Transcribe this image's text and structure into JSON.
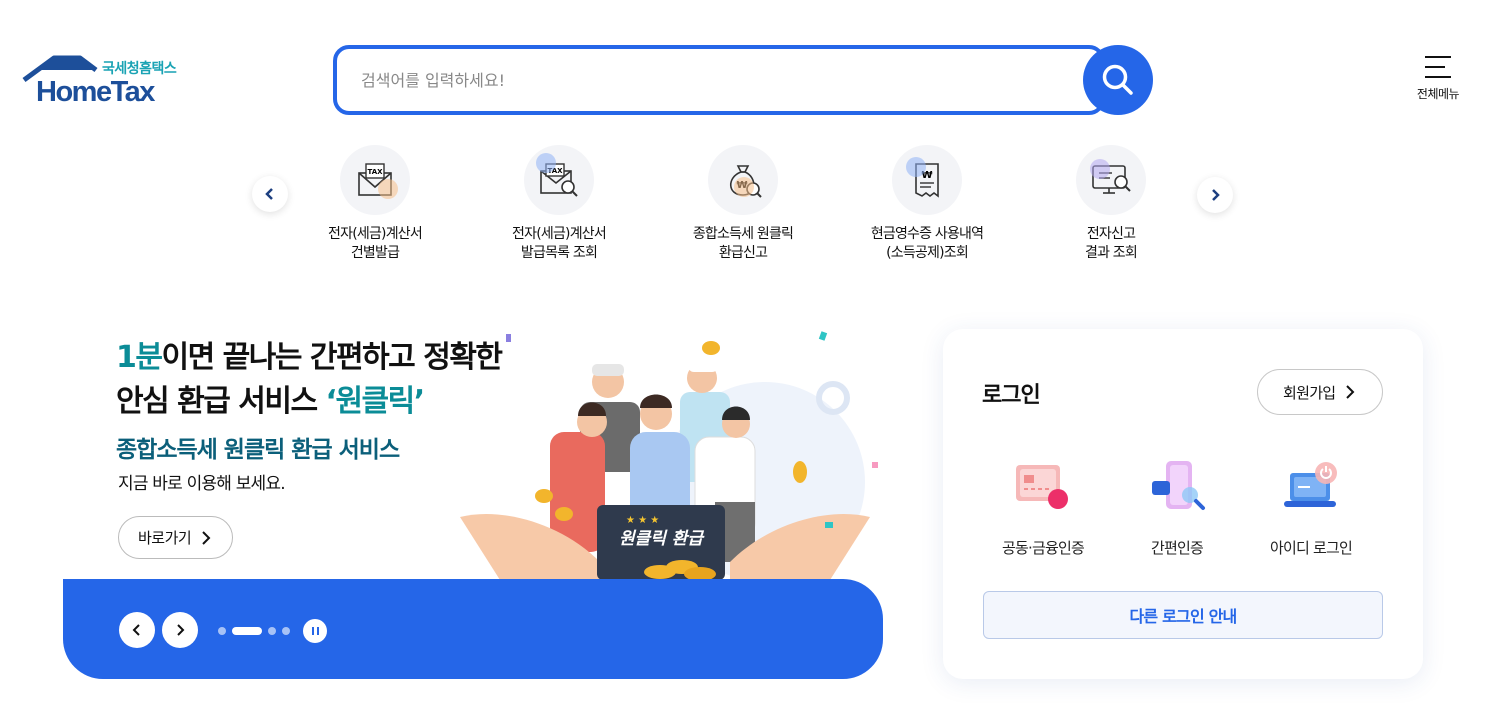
{
  "header": {
    "logo_sub": "국세청홈택스",
    "logo_main": "HomeTax",
    "search_placeholder": "검색어를 입력하세요!",
    "menu_label": "전체메뉴"
  },
  "quick_menu": {
    "items": [
      {
        "label": "전자(세금)계산서\n건별발급",
        "icon": "tax-envelope-icon"
      },
      {
        "label": "전자(세금)계산서\n발급목록 조회",
        "icon": "tax-search-icon"
      },
      {
        "label": "종합소득세 원클릭\n환급신고",
        "icon": "money-bag-icon"
      },
      {
        "label": "현금영수증 사용내역\n(소득공제)조회",
        "icon": "receipt-icon"
      },
      {
        "label": "전자신고\n결과 조회",
        "icon": "monitor-search-icon"
      }
    ]
  },
  "banner": {
    "title_highlight": "1분",
    "title_line1_rest": "이면 끝나는 간편하고 정확한",
    "title_line2": "안심 환급 서비스 ",
    "title_line2_highlight": "‘원클릭’",
    "subtitle": "종합소득세 원클릭 환급 서비스",
    "description": "지금 바로 이용해 보세요.",
    "go_button": "바로가기",
    "sign_text": "원클릭 환급"
  },
  "login": {
    "title": "로그인",
    "join_button": "회원가입",
    "options": [
      {
        "label": "공동·금융인증",
        "icon": "certificate-icon"
      },
      {
        "label": "간편인증",
        "icon": "phone-auth-icon"
      },
      {
        "label": "아이디 로그인",
        "icon": "laptop-id-icon"
      }
    ],
    "other_button": "다른 로그인 안내"
  },
  "colors": {
    "primary": "#2566e8",
    "teal": "#0b8c97",
    "logo_navy": "#1d4f9a"
  }
}
